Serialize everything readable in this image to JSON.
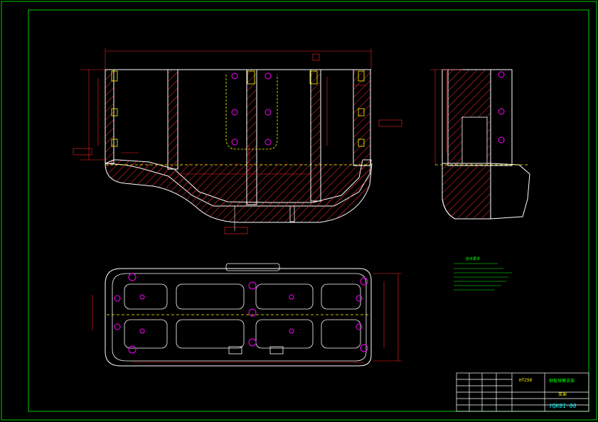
{
  "drawing": {
    "material": "HT250",
    "part_title": "钢板弹簧支架",
    "part_name": "支架",
    "drawing_number": "YQK01-00",
    "notes_title": "技术要求"
  },
  "colors": {
    "background": "#000000",
    "frame": "#00cc00",
    "outline": "#ffffff",
    "dimension": "#ff2020",
    "hatch": "#ff3030",
    "center": "#ffff00",
    "hole": "#ff00ff",
    "title_text": "#00ff00"
  }
}
